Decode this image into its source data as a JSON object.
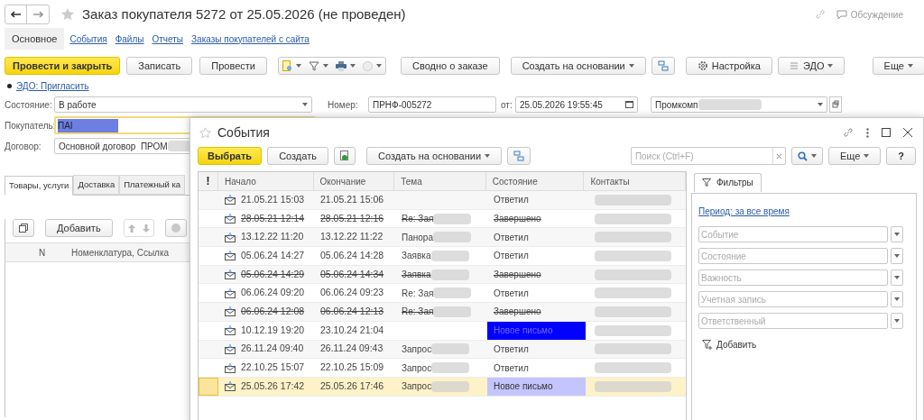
{
  "header": {
    "title": "Заказ покупателя 5272 от 25.05.2026 (не проведен)",
    "discussion": "Обсуждение"
  },
  "nav_tabs": [
    {
      "label": "Основное",
      "selected": true
    },
    {
      "label": "События",
      "selected": false
    },
    {
      "label": "Файлы",
      "selected": false
    },
    {
      "label": "Отчеты",
      "selected": false
    },
    {
      "label": "Заказы покупателей с сайта",
      "selected": false
    }
  ],
  "toolbar": {
    "post_close": "Провести и закрыть",
    "save": "Записать",
    "post": "Провести",
    "summary": "Сводно о заказе",
    "create_based": "Создать на основании",
    "settings": "Настройка",
    "edo": "ЭДО",
    "more": "Еще"
  },
  "edo_link": "ЭДО: Пригласить",
  "fields": {
    "state_label": "Состояние:",
    "state": "В работе",
    "number_label": "Номер:",
    "number": "ПРНФ-005272",
    "date_label": "от:",
    "date": "25.05.2026 19:55:45",
    "org": "Промкомп",
    "buyer_label": "Покупатель:",
    "buyer": "ПАІ",
    "contract_label": "Договор:",
    "contract": "Основной договор  ПРОМ"
  },
  "doc_tabs": [
    {
      "label": "Товары, услуги",
      "selected": true
    },
    {
      "label": "Доставка",
      "selected": false
    },
    {
      "label": "Платежный ка",
      "selected": false
    }
  ],
  "items_toolbar": {
    "add": "Добавить"
  },
  "items_columns": [
    "N",
    "Номенклатура, Ссылка"
  ],
  "events": {
    "title": "События",
    "choose": "Выбрать",
    "create": "Создать",
    "create_based": "Создать на основании",
    "search_placeholder": "Поиск (Ctrl+F)",
    "more": "Еще",
    "help": "?",
    "columns": [
      "!",
      "Начало",
      "Окончание",
      "Тема",
      "Состояние",
      "Контакты"
    ],
    "rows": [
      {
        "start": "21.05.21 15:03",
        "end": "21.05.21 15:06",
        "topic": "",
        "status": "Ответил",
        "deleted": false,
        "selected": false
      },
      {
        "start": "28.05.21 12:14",
        "end": "28.05.21 12:16",
        "topic": "Re: Зая",
        "status": "Завершено",
        "deleted": true,
        "selected": false
      },
      {
        "start": "13.12.22 11:20",
        "end": "13.12.22 11:22",
        "topic": "Панора",
        "status": "Ответил",
        "deleted": false,
        "selected": false
      },
      {
        "start": "05.06.24 14:27",
        "end": "05.06.24 14:28",
        "topic": "Заявка",
        "status": "Ответил",
        "deleted": false,
        "selected": false
      },
      {
        "start": "05.06.24 14:29",
        "end": "05.06.24 14:34",
        "topic": "Заявка",
        "status": "Завершено",
        "deleted": true,
        "selected": false
      },
      {
        "start": "06.06.24 09:20",
        "end": "06.06.24 09:23",
        "topic": "Re: Зая",
        "status": "Ответил",
        "deleted": false,
        "selected": false
      },
      {
        "start": "06.06.24 12:08",
        "end": "06.06.24 12:13",
        "topic": "Re: Зая",
        "status": "Завершено",
        "deleted": true,
        "selected": false
      },
      {
        "start": "10.12.19 19:20",
        "end": "23.10.24 21:04",
        "topic": "",
        "status": "Новое письмо",
        "deleted": false,
        "selected": false,
        "color": "#0000ff"
      },
      {
        "start": "26.11.24 09:40",
        "end": "26.11.24 09:43",
        "topic": "Запрос",
        "status": "Ответил",
        "deleted": false,
        "selected": false
      },
      {
        "start": "22.10.25 15:07",
        "end": "22.10.25 15:09",
        "topic": "Запрос",
        "status": "Ответил",
        "deleted": false,
        "selected": false
      },
      {
        "start": "25.05.26 17:42",
        "end": "25.05.26 17:46",
        "topic": "Запрос",
        "status": "Новое письмо",
        "deleted": false,
        "selected": true,
        "color": "#c4c4ff"
      }
    ],
    "filters": {
      "tab": "Фильтры",
      "period": "Период: за все время",
      "fields": [
        "Событие",
        "Состояние",
        "Важность",
        "Учетная запись",
        "Ответственный"
      ],
      "add": "Добавить"
    }
  }
}
